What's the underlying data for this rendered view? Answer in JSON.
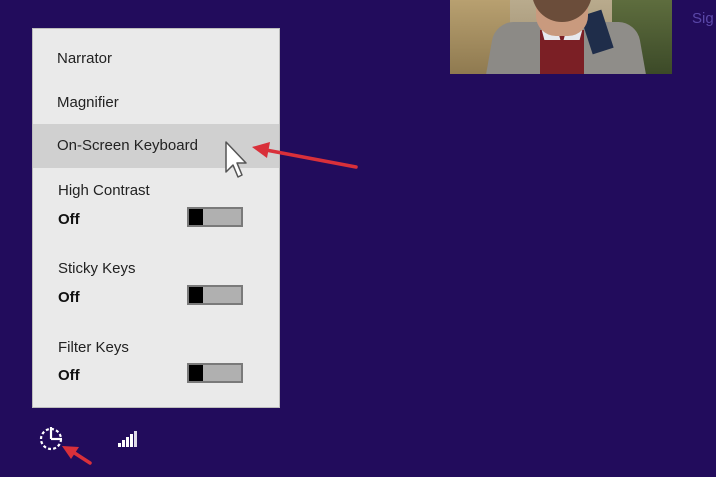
{
  "header": {
    "signin_text": "Sig"
  },
  "ease_menu": {
    "items": [
      {
        "label": "Narrator",
        "active": false
      },
      {
        "label": "Magnifier",
        "active": false
      },
      {
        "label": "On-Screen Keyboard",
        "active": true
      }
    ],
    "toggles": [
      {
        "label": "High Contrast",
        "value": "Off"
      },
      {
        "label": "Sticky Keys",
        "value": "Off"
      },
      {
        "label": "Filter Keys",
        "value": "Off"
      }
    ]
  },
  "icons": {
    "ease_of_access": "ease-of-access-icon",
    "network": "network-signal-icon",
    "cursor": "mouse-pointer-icon",
    "annotation_arrows": "red-arrow-icon"
  },
  "colors": {
    "background": "#220c5c",
    "menu_bg": "#eaeaea",
    "highlight": "#d0d0d0",
    "annotation": "#d9303a"
  }
}
